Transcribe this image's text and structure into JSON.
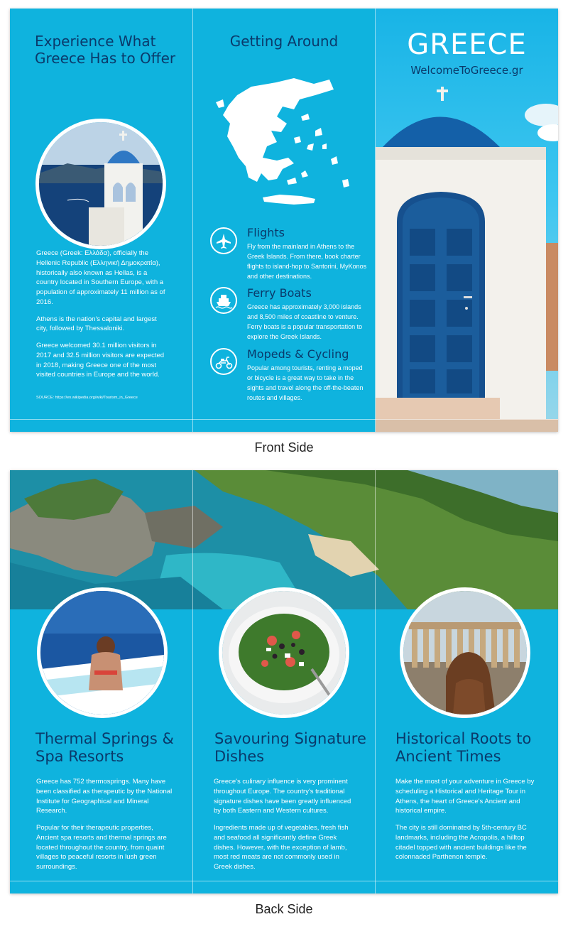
{
  "front": {
    "panel1": {
      "title": "Experience What Greece Has to Offer",
      "paragraphs": [
        "Greece (Greek: Ελλάδα), officially the Hellenic Republic (Ελληνική Δημοκρατία), historically also known as Hellas, is a country located in Southern Europe, with a population of approximately 11 million as of 2016.",
        "Athens is the nation's capital and largest city, followed by Thessaloniki.",
        "Greece welcomed 30.1 million visitors in 2017 and 32.5 million visitors are expected in 2018, making Greece one of the most visited countries in Europe and the world."
      ],
      "source": "SOURCE: https://en.wikipedia.org/wiki/Tourism_in_Greece"
    },
    "panel2": {
      "title": "Getting Around",
      "items": [
        {
          "icon": "airplane-icon",
          "title": "Flights",
          "text": "Fly from the mainland in Athens to the Greek Islands. From there, book charter flights to island-hop to Santorini, MyKonos and other destinations."
        },
        {
          "icon": "ship-icon",
          "title": "Ferry Boats",
          "text": "Greece has approximately 3,000 islands and 8,500 miles of coastline to venture. Ferry boats is a popular transportation to explore the Greek Islands."
        },
        {
          "icon": "scooter-icon",
          "title": "Mopeds & Cycling",
          "text": "Popular among tourists, renting a moped or bicycle is a great way to take in the sights and travel along the off-the-beaten routes and villages."
        }
      ]
    },
    "panel3": {
      "title": "GREECE",
      "website": "WelcomeToGreece.gr"
    }
  },
  "front_caption": "Front Side",
  "back": {
    "panels": [
      {
        "title": "Thermal Springs & Spa Resorts",
        "paragraphs": [
          "Greece has 752 thermosprings. Many have been classified as therapeutic by the National Institute for Geographical and Mineral Research.",
          "Popular for their therapeutic properties, Ancient spa resorts and thermal springs are located throughout the country, from quaint villages to peaceful resorts in lush green surroundings."
        ]
      },
      {
        "title": "Savouring Signature Dishes",
        "paragraphs": [
          "Greece's culinary influence is very prominent throughout Europe. The country's traditional signature dishes have been greatly influenced by both Eastern and Western cultures.",
          "Ingredients made up of vegetables, fresh fish and seafood all significantly define Greek dishes. However, with the exception of lamb, most red meats are not commonly used in Greek dishes."
        ]
      },
      {
        "title": "Historical Roots to Ancient Times",
        "paragraphs": [
          "Make the most of your adventure in Greece by scheduling a Historical and Heritage Tour in Athens, the heart of Greece's Ancient and historical empire.",
          "The city is still dominated by 5th-century BC landmarks, including the Acropolis, a hilltop citadel topped with ancient buildings like the colonnaded Parthenon temple."
        ]
      }
    ]
  },
  "back_caption": "Back Side",
  "colors": {
    "panel_blue": "#0fb3de",
    "title_navy": "#0a3a6b",
    "text_white": "#ffffff"
  }
}
